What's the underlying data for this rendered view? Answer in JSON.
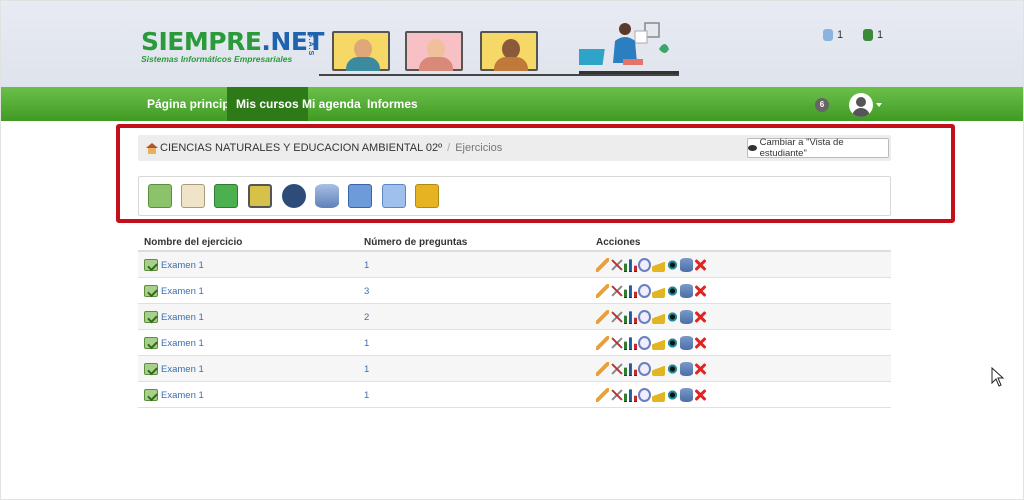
{
  "header": {
    "logo": {
      "part1": "SIEMPRE",
      "part2": ".NET",
      "suffix": "S.A.S",
      "tagline": "Sistemas Informáticos Empresariales"
    },
    "stats": [
      {
        "icon": "user-count-icon",
        "value": "1"
      },
      {
        "icon": "teacher-count-icon",
        "value": "1"
      }
    ]
  },
  "nav": {
    "items": [
      {
        "label": "Página principal",
        "active": false
      },
      {
        "label": "Mis cursos",
        "active": true
      },
      {
        "label": "Mi agenda",
        "active": false
      },
      {
        "label": "Informes",
        "active": false
      }
    ],
    "notifications_count": "6"
  },
  "breadcrumb": {
    "course": "CIENCIAS NATURALES Y EDUCACION AMBIENTAL 02º",
    "separator": "/",
    "current": "Ejercicios",
    "student_view_button": "Cambiar a \"Vista de estudiante\""
  },
  "toolbar": {
    "tools": [
      {
        "icon": "new-exercise-icon",
        "color": "#8cc26a"
      },
      {
        "icon": "question-pool-icon",
        "color": "#e9d9b8"
      },
      {
        "icon": "folder-icon",
        "color": "#4caf50"
      },
      {
        "icon": "import-icon",
        "color": "#c9b23a"
      },
      {
        "icon": "qti-import-icon",
        "color": "#2d4c7a"
      },
      {
        "icon": "database-icon",
        "color": "#6f8fc4"
      },
      {
        "icon": "export-icon",
        "color": "#5b8fd6"
      },
      {
        "icon": "upload-icon",
        "color": "#8fb4e8"
      },
      {
        "icon": "clean-icon",
        "color": "#e6b422"
      }
    ]
  },
  "table": {
    "headers": {
      "name": "Nombre del ejercicio",
      "count": "Número de preguntas",
      "actions": "Acciones"
    },
    "rows": [
      {
        "name": "Examen 1",
        "count": "1"
      },
      {
        "name": "Examen 1",
        "count": "3"
      },
      {
        "name": "Examen 1",
        "count": "2"
      },
      {
        "name": "Examen 1",
        "count": "1"
      },
      {
        "name": "Examen 1",
        "count": "1"
      },
      {
        "name": "Examen 1",
        "count": "1"
      }
    ]
  },
  "colors": {
    "nav_green": "#4fa82e",
    "nav_active": "#2f7a18",
    "highlight_red": "#c30f1a",
    "link_blue": "#3a6fb0"
  }
}
